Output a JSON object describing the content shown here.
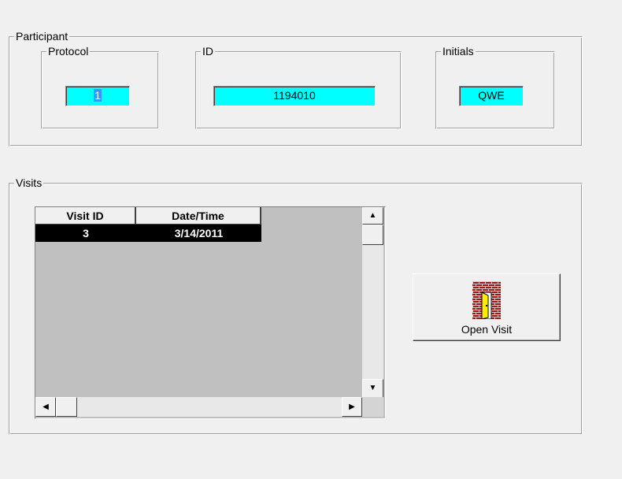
{
  "participant": {
    "title": "Participant",
    "protocol": {
      "label": "Protocol",
      "value": "1"
    },
    "id": {
      "label": "ID",
      "value": "1194010"
    },
    "initials": {
      "label": "Initials",
      "value": "QWE"
    }
  },
  "visits": {
    "title": "Visits",
    "columns": [
      "Visit ID",
      "Date/Time"
    ],
    "rows": [
      {
        "visit_id": "3",
        "date_time": "3/14/2011"
      }
    ],
    "open_button_label": "Open Visit"
  },
  "colors": {
    "field_bg": "#00ffff",
    "selected_row_bg": "#000000",
    "window_bg": "#f0f0f0"
  }
}
